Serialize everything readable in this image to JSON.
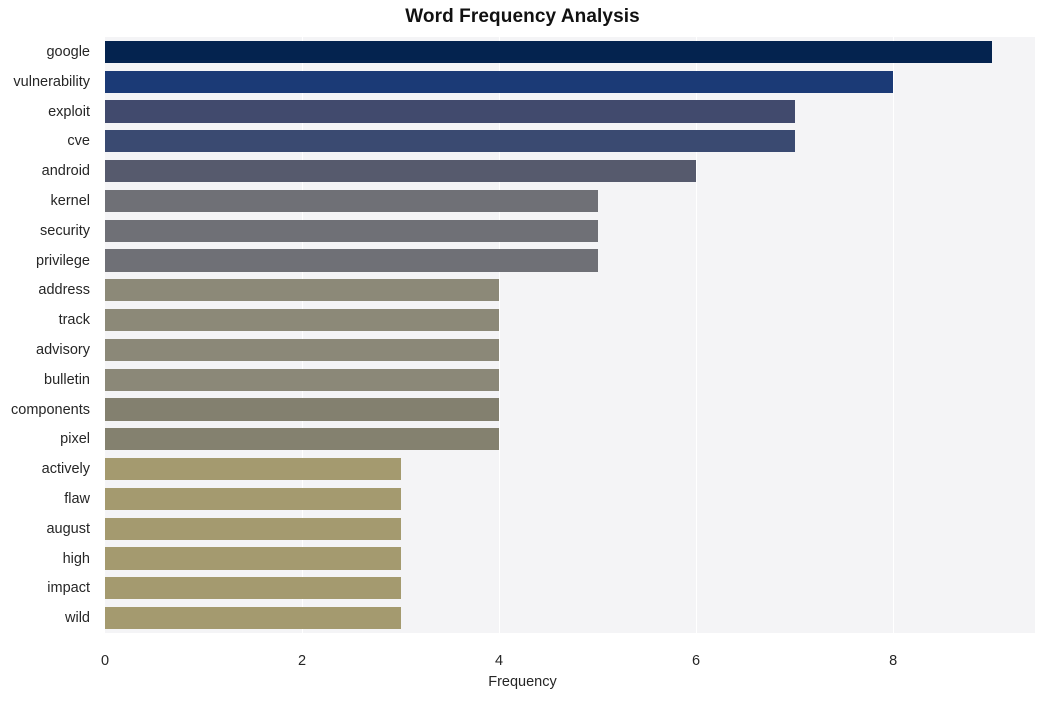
{
  "chart_data": {
    "type": "bar",
    "orientation": "horizontal",
    "title": "Word Frequency Analysis",
    "xlabel": "Frequency",
    "ylabel": "",
    "categories": [
      "google",
      "vulnerability",
      "exploit",
      "cve",
      "android",
      "kernel",
      "security",
      "privilege",
      "address",
      "track",
      "advisory",
      "bulletin",
      "components",
      "pixel",
      "actively",
      "flaw",
      "august",
      "high",
      "impact",
      "wild"
    ],
    "values": [
      9,
      8,
      7,
      7,
      6,
      5,
      5,
      5,
      4,
      4,
      4,
      4,
      4,
      4,
      3,
      3,
      3,
      3,
      3,
      3
    ],
    "bar_colors": [
      "#04234f",
      "#1b3a76",
      "#414a6d",
      "#3a4a71",
      "#565a6d",
      "#6f7076",
      "#6f7076",
      "#6f7076",
      "#8c8978",
      "#8c8978",
      "#8b8878",
      "#8b8878",
      "#83806f",
      "#84816f",
      "#a49a6f",
      "#a49a6f",
      "#a49a6f",
      "#a49a6f",
      "#a49a6f",
      "#a49a6f"
    ],
    "xlim": [
      0,
      9.44
    ],
    "ylim_categories": 20,
    "x_ticks": [
      "0",
      "2",
      "4",
      "6",
      "8"
    ],
    "x_tick_values": [
      0,
      2,
      4,
      6,
      8
    ],
    "grid": true,
    "grid_axis": "x",
    "grid_color": "#ffffff",
    "plot_background": "#f4f4f6",
    "figure_background": "#ffffff",
    "legend": null,
    "legend_position": "none"
  }
}
